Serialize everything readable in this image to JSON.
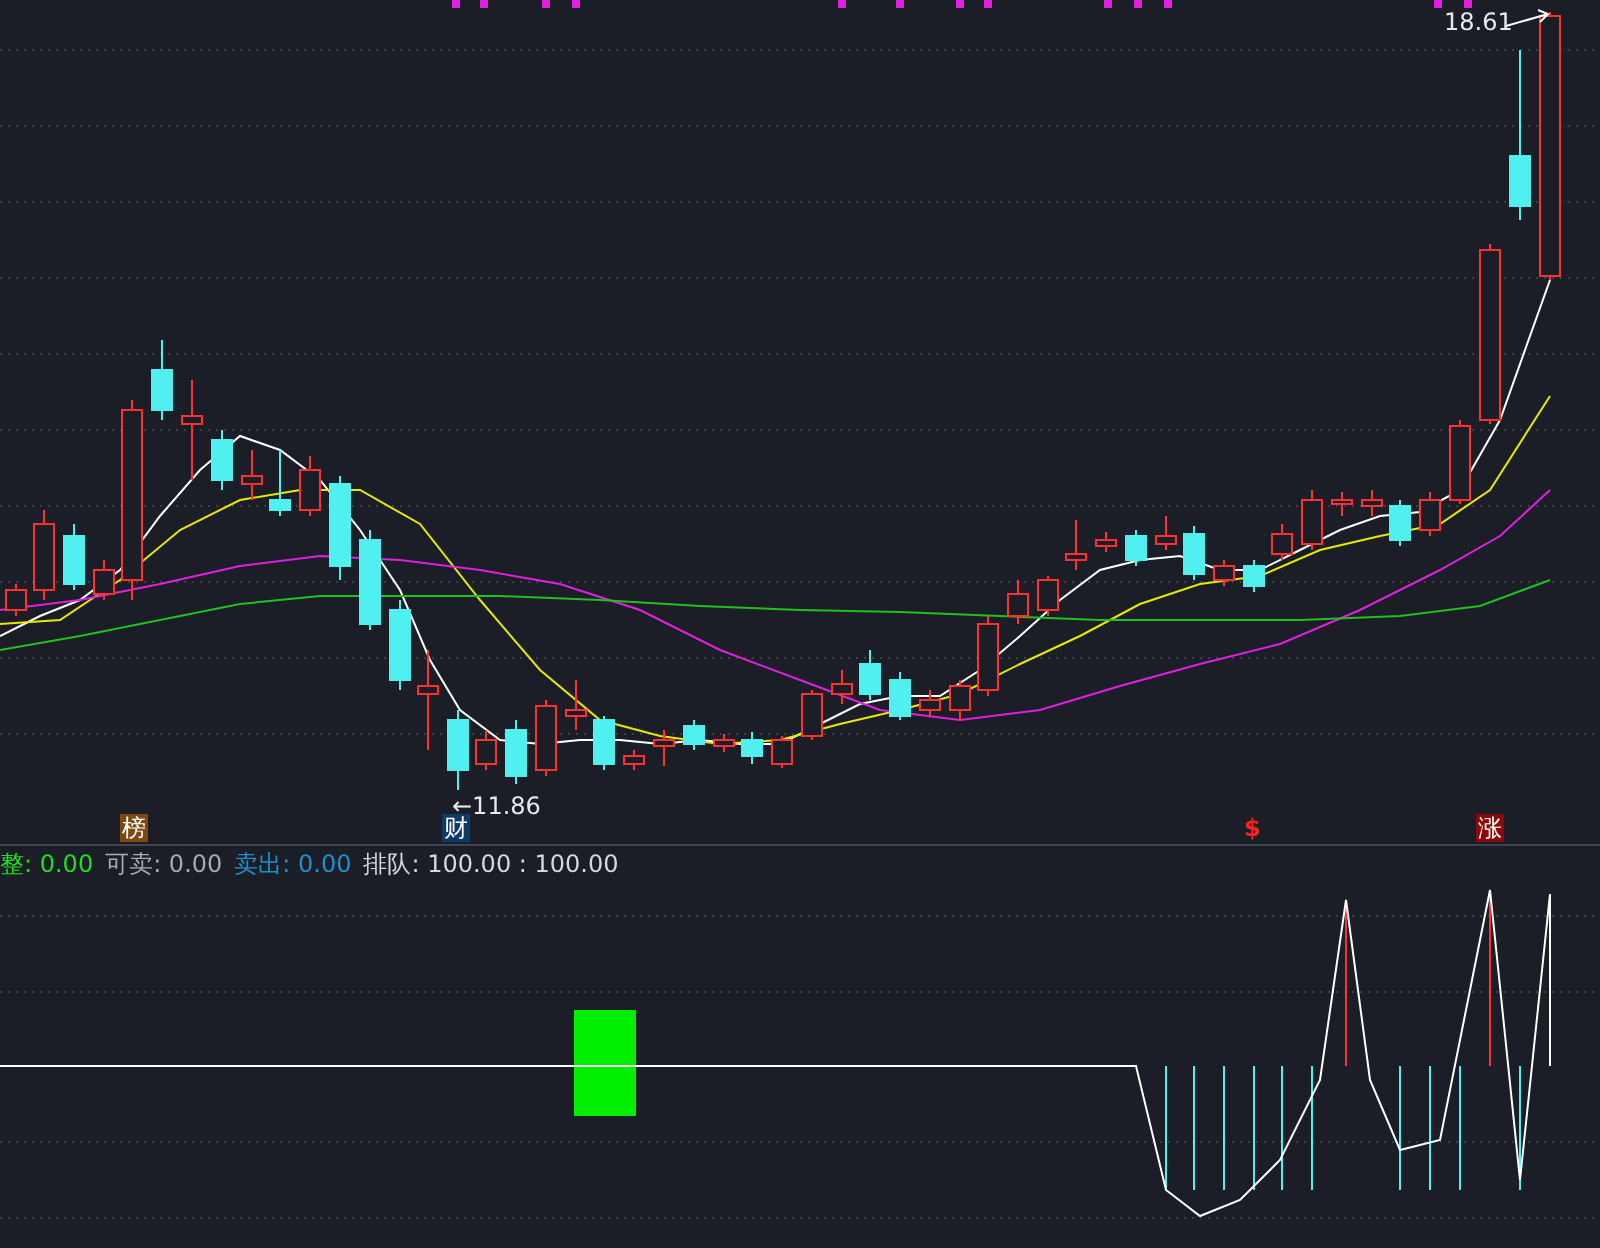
{
  "price_pane": {
    "high_label": "18.61",
    "low_label": "←11.86",
    "markers": [
      {
        "kind": "list",
        "text": "榜"
      },
      {
        "kind": "finance",
        "text": "财"
      },
      {
        "kind": "dollar",
        "text": "$"
      },
      {
        "kind": "limit-up",
        "text": "涨"
      }
    ]
  },
  "indicator_readout": [
    {
      "label": "整:",
      "value": "0.00",
      "color": "#22dd22"
    },
    {
      "label": "可卖:",
      "value": "0.00",
      "color": "#aaaaaa"
    },
    {
      "label": "卖出:",
      "value": "0.00",
      "color": "#1e90d0"
    },
    {
      "label": "排队:",
      "value": "100.00 : 100.00",
      "color": "#d8d8d8"
    }
  ]
}
